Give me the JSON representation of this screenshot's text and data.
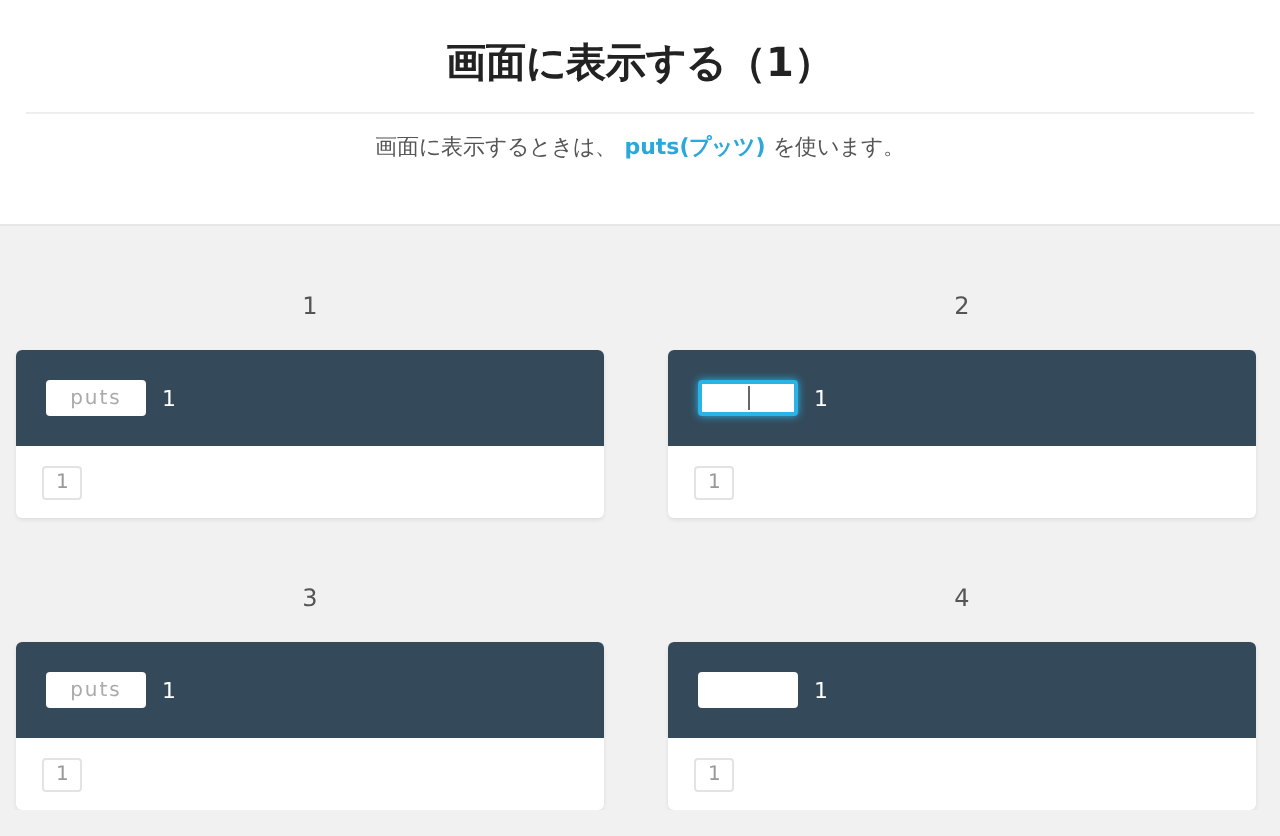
{
  "title": "画面に表示する（1）",
  "intro": "画面に表示するときは、 **puts(プッツ)** を使います。",
  "steps": [
    {
      "label": "1",
      "input": {
        "placeholder": "puts",
        "focused": false
      },
      "output": "1",
      "result": "1"
    },
    {
      "label": "2",
      "input": {
        "focused": true
      },
      "output": "1",
      "result": "1"
    },
    {
      "label": "3",
      "input": {
        "placeholder": "puts",
        "focused": false
      },
      "output": "1",
      "result": "1"
    },
    {
      "label": "4",
      "input": {
        "focused": false
      },
      "output": "1",
      "result": "1"
    }
  ]
}
